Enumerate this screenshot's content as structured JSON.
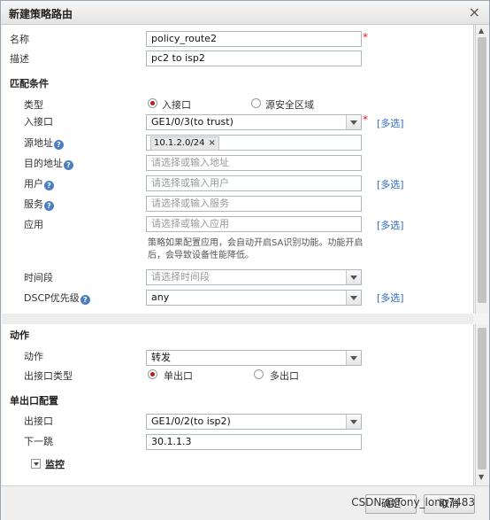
{
  "dialog": {
    "title": "新建策略路由",
    "close_symbol": "×"
  },
  "basic": {
    "name_label": "名称",
    "name_value": "policy_route2",
    "desc_label": "描述",
    "desc_value": "pc2 to isp2",
    "required_mark": "*"
  },
  "match": {
    "section": "匹配条件",
    "type_label": "类型",
    "type_options": [
      "入接口",
      "源安全区域"
    ],
    "in_if_label": "入接口",
    "in_if_value": "GE1/0/3(to trust)",
    "src_label": "源地址",
    "src_tag": "10.1.2.0/24",
    "tag_remove": "×",
    "dst_label": "目的地址",
    "dst_placeholder": "请选择或输入地址",
    "user_label": "用户",
    "user_placeholder": "请选择或输入用户",
    "service_label": "服务",
    "service_placeholder": "请选择或输入服务",
    "app_label": "应用",
    "app_placeholder": "请选择或输入应用",
    "app_note": "策略如果配置应用，会自动开启SA识别功能。功能开启后，会导致设备性能降低。",
    "time_label": "时间段",
    "time_placeholder": "请选择时间段",
    "dscp_label": "DSCP优先级",
    "dscp_value": "any",
    "more_label": "[多选]",
    "help_symbol": "?"
  },
  "action": {
    "section": "动作",
    "action_label": "动作",
    "action_value": "转发",
    "out_type_label": "出接口类型",
    "out_type_options": [
      "单出口",
      "多出口"
    ]
  },
  "single": {
    "section": "单出口配置",
    "out_if_label": "出接口",
    "out_if_value": "GE1/0/2(to isp2)",
    "nexthop_label": "下一跳",
    "nexthop_value": "30.1.1.3",
    "monitor_label": "监控"
  },
  "footer": {
    "ok_label": "确定",
    "cancel_label": "取消"
  },
  "watermark": "CSDN @Tony_long7483"
}
